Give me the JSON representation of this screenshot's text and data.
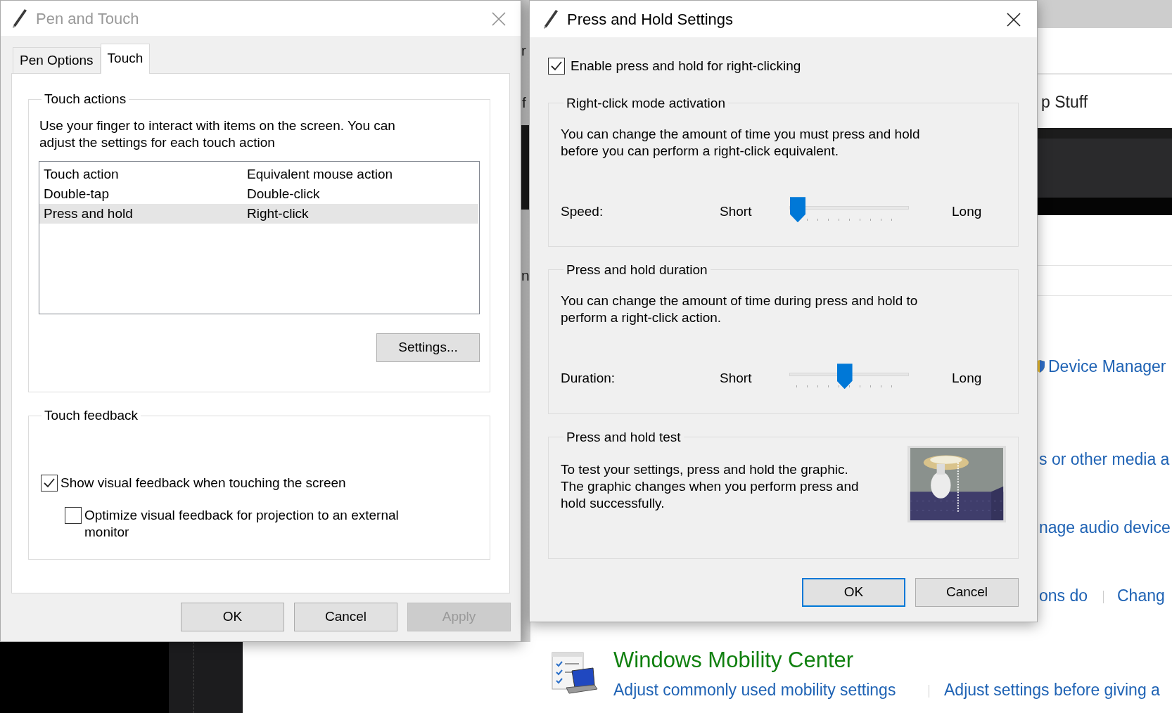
{
  "background": {
    "texts": [
      {
        "kind": "fragment",
        "text": "r"
      },
      {
        "kind": "fragment",
        "text": "f"
      },
      {
        "kind": "fragment",
        "text": "n"
      },
      {
        "kind": "fragment",
        "text": "p Stuff"
      },
      {
        "kind": "link",
        "text": "Device Manager"
      },
      {
        "kind": "link",
        "text": "s or other media a"
      },
      {
        "kind": "link",
        "text": "nage audio device"
      },
      {
        "kind": "link",
        "text": "ons do"
      },
      {
        "kind": "link",
        "text": "Chang"
      },
      {
        "kind": "heading",
        "text": "Windows Mobility Center"
      },
      {
        "kind": "link",
        "text": "Adjust commonly used mobility settings"
      },
      {
        "kind": "link",
        "text": "Adjust settings before giving a"
      }
    ]
  },
  "pen_and_touch": {
    "title": "Pen and Touch",
    "active": false,
    "tabs": [
      {
        "label": "Pen Options",
        "selected": false
      },
      {
        "label": "Touch",
        "selected": true
      }
    ],
    "touch_actions": {
      "legend": "Touch actions",
      "description": "Use your finger to interact with items on the screen. You can adjust the settings for each touch action",
      "columns": [
        "Touch action",
        "Equivalent mouse action"
      ],
      "rows": [
        {
          "cells": [
            "Double-tap",
            "Double-click"
          ],
          "selected": false
        },
        {
          "cells": [
            "Press and hold",
            "Right-click"
          ],
          "selected": true
        }
      ],
      "settings_button": "Settings..."
    },
    "touch_feedback": {
      "legend": "Touch feedback",
      "options": [
        {
          "label": "Show visual feedback when touching the screen",
          "checked": true
        },
        {
          "label": "Optimize visual feedback for projection to an external monitor",
          "checked": false
        }
      ]
    },
    "buttons": [
      {
        "label": "OK",
        "disabled": false
      },
      {
        "label": "Cancel",
        "disabled": false
      },
      {
        "label": "Apply",
        "disabled": true
      }
    ]
  },
  "press_and_hold": {
    "title": "Press and Hold Settings",
    "active": true,
    "enable": {
      "label": "Enable press and hold for right-clicking",
      "checked": true
    },
    "groups": [
      {
        "kind": "slider",
        "legend": "Right-click mode activation",
        "description": "You can change the amount of time you must press and hold before you can perform a right-click equivalent.",
        "slider": {
          "label": "Speed:",
          "min_label": "Short",
          "max_label": "Long",
          "level": 0
        }
      },
      {
        "kind": "slider",
        "legend": "Press and hold duration",
        "description": "You can change the amount of time during press and hold to perform a right-click action.",
        "slider": {
          "label": "Duration:",
          "min_label": "Short",
          "max_label": "Long",
          "level": 0.45
        }
      },
      {
        "kind": "test",
        "legend": "Press and hold test",
        "description": "To test your settings, press and hold the graphic. The graphic changes when you perform press and hold successfully."
      }
    ],
    "buttons": [
      {
        "label": "OK",
        "default": true
      },
      {
        "label": "Cancel",
        "default": false
      }
    ]
  }
}
